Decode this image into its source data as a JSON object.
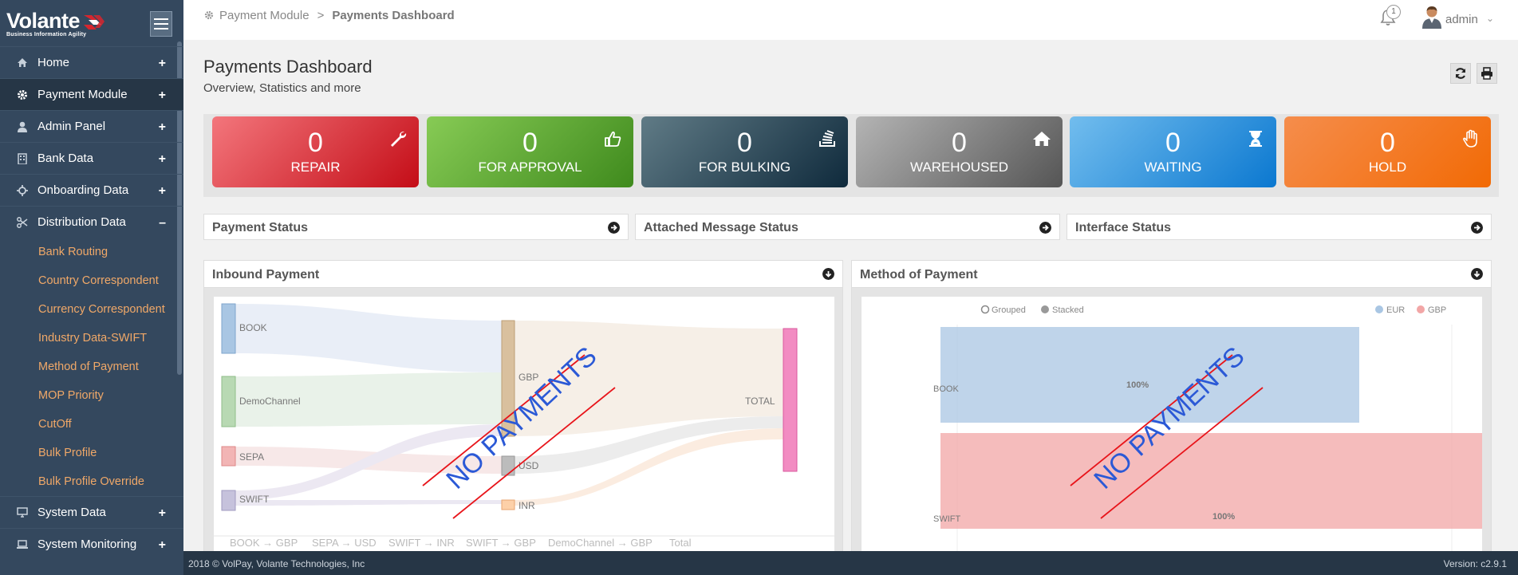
{
  "app": {
    "logo_text": "Volante",
    "logo_tagline": "Business Information Agility"
  },
  "sidebar": {
    "items": [
      {
        "label": "Home",
        "icon": "home-icon",
        "expander": "+"
      },
      {
        "label": "Payment Module",
        "icon": "gear-icon",
        "expander": "+"
      },
      {
        "label": "Admin Panel",
        "icon": "user-icon",
        "expander": "+"
      },
      {
        "label": "Bank Data",
        "icon": "building-icon",
        "expander": "+"
      },
      {
        "label": "Onboarding Data",
        "icon": "crosshair-icon",
        "expander": "+"
      },
      {
        "label": "Distribution Data",
        "icon": "scissors-icon",
        "expander": "–"
      }
    ],
    "sub_items": [
      "Bank Routing",
      "Country Correspondent",
      "Currency Correspondent",
      "Industry Data-SWIFT",
      "Method of Payment",
      "MOP Priority",
      "CutOff",
      "Bulk Profile",
      "Bulk Profile Override"
    ],
    "bottom_items": [
      {
        "label": "System Data",
        "icon": "monitor-icon",
        "expander": "+"
      },
      {
        "label": "System Monitoring",
        "icon": "laptop-icon",
        "expander": "+"
      }
    ]
  },
  "topbar": {
    "breadcrumb_parent": "Payment Module",
    "breadcrumb_separator": ">",
    "breadcrumb_current": "Payments Dashboard",
    "notification_count": "1",
    "username": "admin"
  },
  "page": {
    "title": "Payments Dashboard",
    "subtitle": "Overview, Statistics and more"
  },
  "stats": [
    {
      "value": "0",
      "label": "REPAIR",
      "icon": "wrench-icon",
      "color_from": "#f3767c",
      "color_to": "#c40d17"
    },
    {
      "value": "0",
      "label": "FOR APPROVAL",
      "icon": "thumbs-up-icon",
      "color_from": "#87cb55",
      "color_to": "#3f8a1d"
    },
    {
      "value": "0",
      "label": "FOR BULKING",
      "icon": "stack-icon",
      "color_from": "#607b86",
      "color_to": "#0f2a3c"
    },
    {
      "value": "0",
      "label": "WAREHOUSED",
      "icon": "house-icon",
      "color_from": "#b4b4b4",
      "color_to": "#555555"
    },
    {
      "value": "0",
      "label": "WAITING",
      "icon": "hourglass-icon",
      "color_from": "#72bdee",
      "color_to": "#0b78d0"
    },
    {
      "value": "0",
      "label": "HOLD",
      "icon": "hand-icon",
      "color_from": "#f58d4c",
      "color_to": "#f26a05"
    }
  ],
  "status_panels": [
    {
      "title": "Payment Status"
    },
    {
      "title": "Attached Message Status"
    },
    {
      "title": "Interface Status"
    }
  ],
  "inbound_payment": {
    "title": "Inbound Payment",
    "overlay": "NO PAYMENTS",
    "nodes_left": [
      "BOOK",
      "DemoChannel",
      "SEPA",
      "SWIFT"
    ],
    "nodes_mid": [
      "GBP",
      "USD",
      "INR"
    ],
    "node_right": "TOTAL",
    "axis_labels": [
      "BOOK → GBP",
      "SEPA → USD",
      "SWIFT → INR",
      "SWIFT → GBP",
      "DemoChannel → GBP",
      "Total"
    ]
  },
  "method_of_payment": {
    "title": "Method of Payment",
    "overlay": "NO PAYMENTS",
    "toggle_options": [
      "Grouped",
      "Stacked"
    ],
    "selected_toggle": "Stacked",
    "legend": [
      {
        "name": "EUR",
        "color": "#a9c6e3"
      },
      {
        "name": "GBP",
        "color": "#f2a6a6"
      }
    ],
    "categories": [
      "BOOK",
      "SWIFT"
    ],
    "bar_labels": [
      "100%",
      "100%"
    ]
  },
  "chart_data": {
    "type": "bar",
    "orientation": "horizontal",
    "stacked": true,
    "categories": [
      "BOOK",
      "SWIFT"
    ],
    "series": [
      {
        "name": "EUR",
        "values": [
          100,
          0
        ]
      },
      {
        "name": "GBP",
        "values": [
          0,
          100
        ]
      }
    ]
  },
  "footer": {
    "copyright": "2018 © VolPay, Volante Technologies, Inc",
    "version": "Version: c2.9.1"
  }
}
